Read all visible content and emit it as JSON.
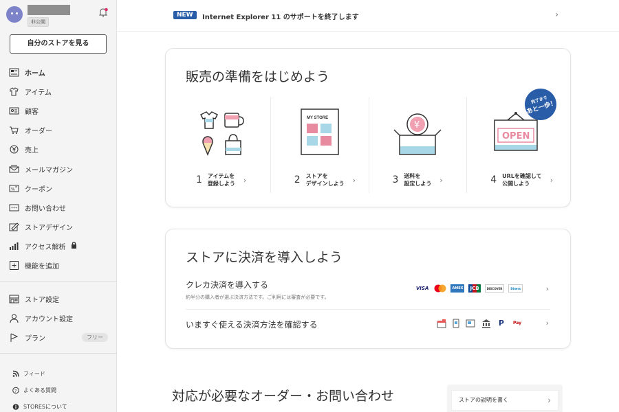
{
  "sidebar": {
    "user_badge": "非公開",
    "view_store_label": "自分のストアを見る",
    "nav": [
      {
        "label": "ホーム",
        "icon": "home-icon"
      },
      {
        "label": "アイテム",
        "icon": "shirt-icon"
      },
      {
        "label": "顧客",
        "icon": "customer-card-icon"
      },
      {
        "label": "オーダー",
        "icon": "cart-icon"
      },
      {
        "label": "売上",
        "icon": "yen-icon"
      },
      {
        "label": "メールマガジン",
        "icon": "mail-icon"
      },
      {
        "label": "クーポン",
        "icon": "coupon-icon"
      },
      {
        "label": "お問い合わせ",
        "icon": "chat-icon"
      },
      {
        "label": "ストアデザイン",
        "icon": "design-icon"
      },
      {
        "label": "アクセス解析",
        "icon": "chart-icon"
      },
      {
        "label": "機能を追加",
        "icon": "plus-icon"
      }
    ],
    "settings": [
      {
        "label": "ストア設定",
        "icon": "store-icon"
      },
      {
        "label": "アカウント設定",
        "icon": "person-icon"
      },
      {
        "label": "プラン",
        "icon": "flag-icon",
        "badge": "フリー"
      }
    ],
    "footer": [
      {
        "label": "フィード",
        "icon": "rss-icon"
      },
      {
        "label": "よくある質問",
        "icon": "question-icon"
      },
      {
        "label": "STORESについて",
        "icon": "info-icon"
      }
    ]
  },
  "banner": {
    "badge": "NEW",
    "text": "Internet Explorer 11 のサポートを終了します"
  },
  "setup": {
    "title": "販売の準備をはじめよう",
    "stamp_line1": "完了まで",
    "stamp_line2": "あと一歩！",
    "steps": [
      {
        "num": "1",
        "line1": "アイテムを",
        "line2": "登録しよう"
      },
      {
        "num": "2",
        "line1": "ストアを",
        "line2": "デザインしよう"
      },
      {
        "num": "3",
        "line1": "送料を",
        "line2": "設定しよう"
      },
      {
        "num": "4",
        "line1": "URLを確認して",
        "line2": "公開しよう"
      }
    ],
    "store_sign": "MY STORE",
    "open_sign": "OPEN",
    "yen": "¥"
  },
  "payment": {
    "title": "ストアに決済を導入しよう",
    "card_title": "クレカ決済を導入する",
    "card_sub": "約半分の購入者が選ぶ決済方法です。ご利用には審査が必要です。",
    "card_logos": [
      "VISA",
      "●●",
      "AMEX",
      "JCB",
      "DISCOVER",
      "Diners"
    ],
    "now_title": "いますぐ使える決済方法を確認する",
    "now_logos": [
      "store",
      "phone",
      "atm",
      "bank",
      "P",
      "Pay"
    ]
  },
  "orders": {
    "title": "対応が必要なオーダー・お問い合わせ",
    "side_button": "ストアの説明を書く"
  },
  "colors": {
    "accent": "#2a5da8",
    "sidebar_bg": "#f4f4f4"
  }
}
